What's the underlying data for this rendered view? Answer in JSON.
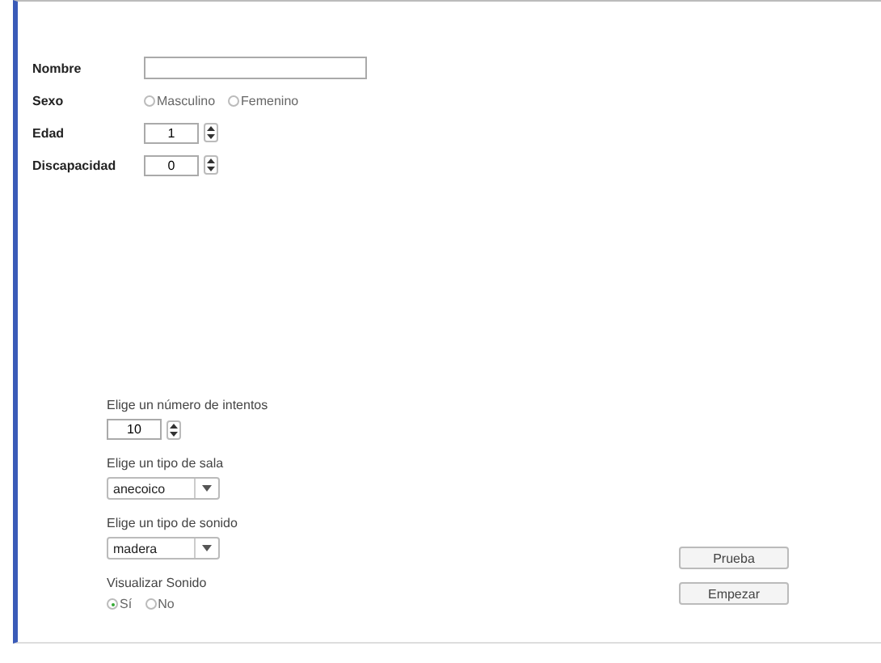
{
  "personal_fields": [
    {
      "kind": "text",
      "label": "Nombre"
    },
    {
      "kind": "radio",
      "label": "Sexo",
      "options": [
        {
          "label": "Masculino",
          "selected": false
        },
        {
          "label": "Femenino",
          "selected": false
        }
      ]
    },
    {
      "kind": "spinner",
      "label": "Edad",
      "value": "1"
    },
    {
      "kind": "spinner",
      "label": "Discapacidad",
      "value": "0"
    }
  ],
  "settings": [
    {
      "kind": "spinner",
      "label": "Elige un número de intentos",
      "value": "10"
    },
    {
      "kind": "select",
      "label": "Elige un tipo de sala",
      "value": "anecoico"
    },
    {
      "kind": "select",
      "label": "Elige un tipo de sonido",
      "value": "madera"
    },
    {
      "kind": "radio",
      "label": "Visualizar Sonido",
      "options": [
        {
          "label": "Sí",
          "selected": true
        },
        {
          "label": "No",
          "selected": false
        }
      ]
    }
  ],
  "buttons": [
    "Prueba",
    "Empezar"
  ]
}
